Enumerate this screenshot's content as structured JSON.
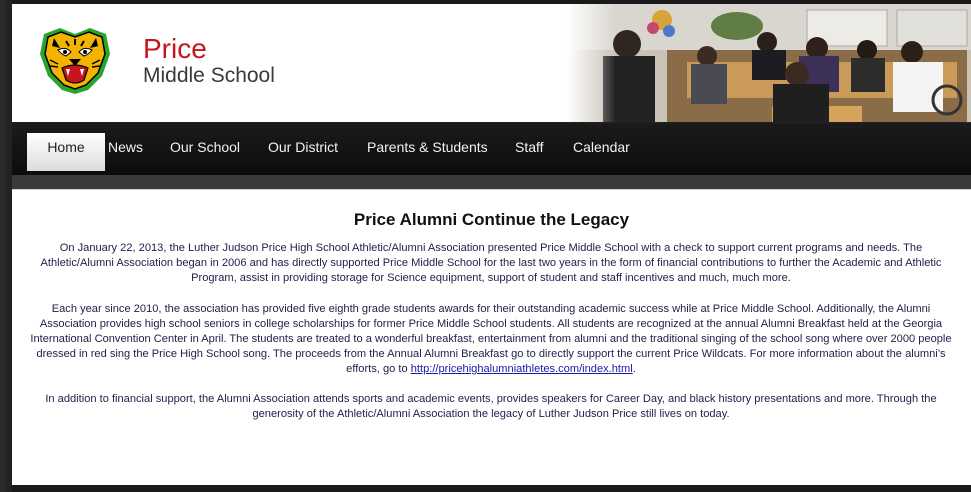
{
  "header": {
    "school_line1": "Price",
    "school_line2": "Middle School",
    "logo_icon": "wildcat-mascot-icon",
    "photo": "classroom-photo"
  },
  "nav": {
    "items": [
      {
        "label": "Home",
        "active": true
      },
      {
        "label": "News"
      },
      {
        "label": "Our School"
      },
      {
        "label": "Our District"
      },
      {
        "label": "Parents & Students"
      },
      {
        "label": "Staff"
      },
      {
        "label": "Calendar"
      }
    ]
  },
  "article": {
    "title": "Price Alumni Continue the Legacy",
    "p1": "On January 22, 2013, the Luther Judson Price High School Athletic/Alumni Association presented Price Middle School with a check to support current programs and needs.  The Athletic/Alumni Association began in 2006 and has directly supported Price Middle School for the last two years in the form of financial contributions to further the Academic and Athletic Program, assist in providing storage for Science equipment, support of student and staff incentives and much, much more.",
    "p2": "Each year since 2010, the association has provided five eighth grade students awards for their outstanding academic success while at Price Middle School.  Additionally, the Alumni Association provides high school seniors in college scholarships for former Price Middle School students.  All students are recognized at the annual Alumni Breakfast held at the Georgia International Convention Center in April.  The students are treated to a wonderful breakfast, entertainment from alumni and the traditional singing of the school song where over 2000 people dressed in red sing the Price High School song.    The proceeds from the Annual Alumni Breakfast go to directly support the current Price Wildcats.  For more information about the alumni’s efforts, go to ",
    "p2_link": "http://pricehighalumniathletes.com/index.html",
    "p2_end": ".",
    "p3": "In addition to financial support, the Alumni Association attends sports and academic events, provides speakers for Career Day, and black history presentations and more.  Through the generosity of the Athletic/Alumni Association the legacy of Luther Judson Price still lives on today."
  },
  "colors": {
    "brand_red": "#c4161c",
    "nav_bg": "#111111",
    "text_navy": "#1f1f4a"
  }
}
